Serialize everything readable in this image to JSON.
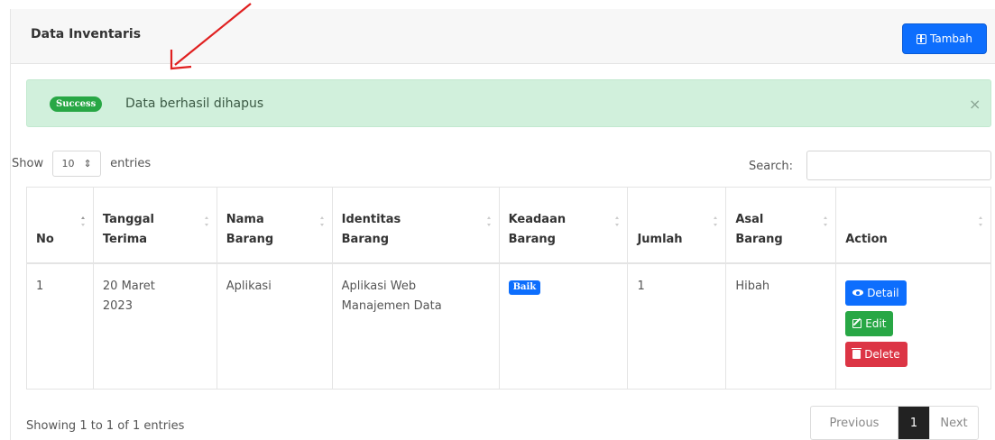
{
  "card": {
    "title": "Data Inventaris",
    "add_button_label": "Tambah"
  },
  "alert": {
    "badge": "Success",
    "message": "Data berhasil dihapus",
    "close_symbol": "×"
  },
  "length": {
    "prefix": "Show",
    "selected": "10",
    "suffix": "entries"
  },
  "search": {
    "label": "Search:",
    "value": ""
  },
  "table": {
    "headers": [
      "No",
      "Tanggal Terima",
      "Nama Barang",
      "Identitas Barang",
      "Keadaan Barang",
      "Jumlah",
      "Asal Barang",
      "Action"
    ],
    "rows": [
      {
        "no": "1",
        "tanggal": "20 Maret 2023",
        "nama": "Aplikasi",
        "identitas": "Aplikasi Web Manajemen Data",
        "keadaan": "Baik",
        "jumlah": "1",
        "asal": "Hibah",
        "actions": {
          "detail": "Detail",
          "edit": "Edit",
          "delete": "Delete"
        }
      }
    ]
  },
  "footer": {
    "info": "Showing 1 to 1 of 1 entries",
    "prev": "Previous",
    "page": "1",
    "next": "Next"
  },
  "colors": {
    "primary": "#0d6efd",
    "success": "#28a745",
    "danger": "#dc3545",
    "alert_bg": "#d1f0dc",
    "annotation_arrow": "#e02020"
  },
  "icons": {
    "add": "plus-square-icon",
    "detail": "eye-icon",
    "edit": "edit-icon",
    "delete": "trash-icon",
    "close": "close-icon",
    "annotation": "red-arrow-icon"
  }
}
